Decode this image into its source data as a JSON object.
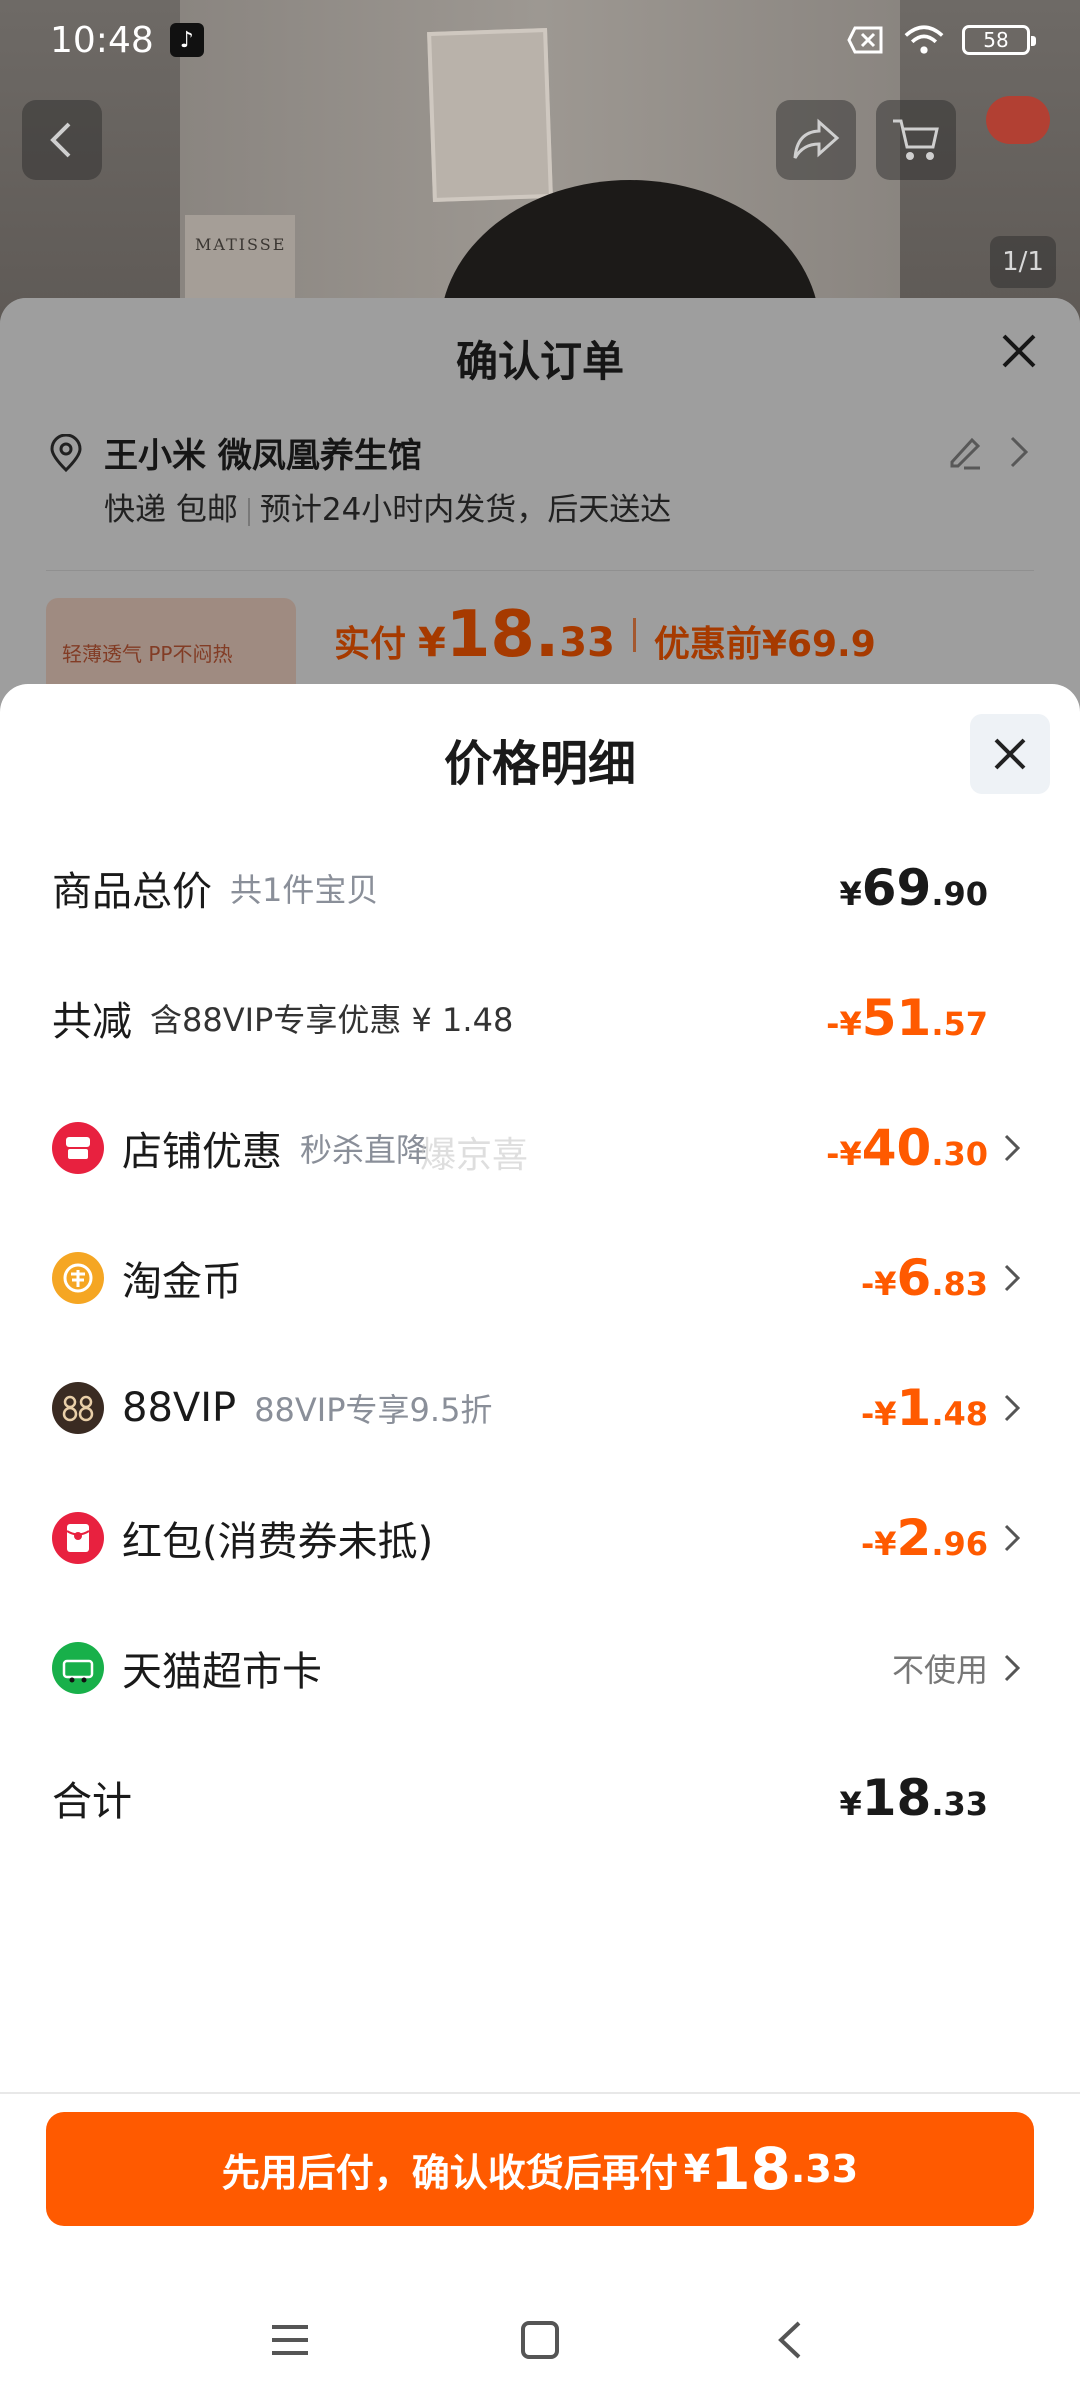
{
  "status_bar": {
    "time": "10:48",
    "battery": "58"
  },
  "photo": {
    "pager": "1/1",
    "poster_text": "MATISSE"
  },
  "order": {
    "title": "确认订单",
    "address_name": "王小米 微凤凰养生馆",
    "delivery_type": "快递 包邮",
    "delivery_eta": "预计24小时内发货，后天送达",
    "product_tag": "轻薄透气 PP不闷热",
    "paid_label": "实付",
    "paid_yen": "¥",
    "paid_int": "18.",
    "paid_dec": "33",
    "before_label": "优惠前¥69.9"
  },
  "detail": {
    "title": "价格明细",
    "rows": [
      {
        "label": "商品总价",
        "note": "共1件宝贝",
        "sign": "",
        "yen": "¥",
        "int": "69",
        "dec": ".90"
      },
      {
        "label": "共减",
        "note": "含88VIP专享优惠 ¥ 1.48",
        "sign": "-",
        "yen": "¥",
        "int": "51",
        "dec": ".57"
      },
      {
        "label": "店铺优惠",
        "note": "秒杀直降",
        "sign": "-",
        "yen": "¥",
        "int": "40",
        "dec": ".30"
      },
      {
        "label": "淘金币",
        "note": "",
        "sign": "-",
        "yen": "¥",
        "int": "6",
        "dec": ".83"
      },
      {
        "label": "88VIP",
        "note": "88VIP专享9.5折",
        "sign": "-",
        "yen": "¥",
        "int": "1",
        "dec": ".48"
      },
      {
        "label": "红包(消费券未抵)",
        "note": "",
        "sign": "-",
        "yen": "¥",
        "int": "2",
        "dec": ".96"
      },
      {
        "label": "天猫超市卡",
        "note": "",
        "status": "不使用"
      },
      {
        "label": "合计",
        "note": "",
        "sign": "",
        "yen": "¥",
        "int": "18",
        "dec": ".33"
      }
    ],
    "watermark": "爆京喜"
  },
  "pay_button": {
    "text": "先用后付，确认收货后再付",
    "yen": "¥",
    "int": "18",
    "dec": ".33"
  },
  "colors": {
    "accent": "#ff5a00",
    "shop_icon": "#e8213f",
    "coin_icon": "#f5a623",
    "vip_icon": "#3a2b22",
    "redpacket_icon": "#e8213f",
    "market_icon": "#18b04a"
  }
}
